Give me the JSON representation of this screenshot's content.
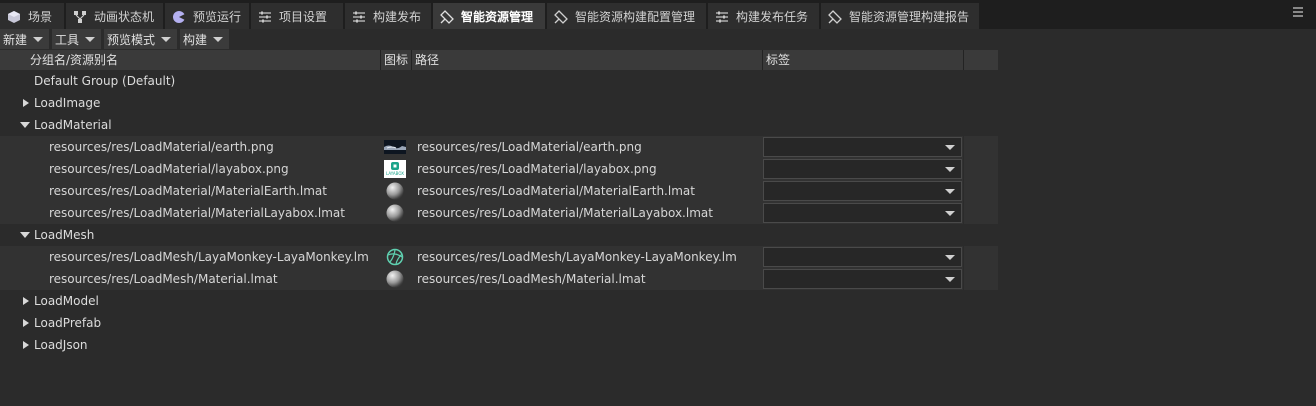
{
  "tabs": [
    {
      "label": "场景",
      "icon": "scene-icon"
    },
    {
      "label": "动画状态机",
      "icon": "state-machine-icon"
    },
    {
      "label": "预览运行",
      "icon": "preview-run-icon"
    },
    {
      "label": "项目设置",
      "icon": "settings-sliders-icon"
    },
    {
      "label": "构建发布",
      "icon": "build-publish-icon"
    },
    {
      "label": "智能资源管理",
      "icon": "smart-asset-icon"
    },
    {
      "label": "智能资源构建配置管理",
      "icon": "smart-asset-config-icon"
    },
    {
      "label": "构建发布任务",
      "icon": "build-task-icon"
    },
    {
      "label": "智能资源管理构建报告",
      "icon": "smart-asset-report-icon"
    }
  ],
  "active_tab": "智能资源管理",
  "toolbar": {
    "new": "新建",
    "tools": "工具",
    "preview_mode": "预览模式",
    "build": "构建"
  },
  "columns": {
    "name": "分组名/资源别名",
    "icon": "图标",
    "path": "路径",
    "tag": "标签"
  },
  "default_group": "Default Group (Default)",
  "groups": [
    {
      "name": "LoadImage",
      "expanded": false
    },
    {
      "name": "LoadMaterial",
      "expanded": true
    },
    {
      "name": "LoadMesh",
      "expanded": true
    },
    {
      "name": "LoadModel",
      "expanded": false
    },
    {
      "name": "LoadPrefab",
      "expanded": false
    },
    {
      "name": "LoadJson",
      "expanded": false
    }
  ],
  "assets": {
    "material_earth_png": {
      "name": "resources/res/LoadMaterial/earth.png",
      "path": "resources/res/LoadMaterial/earth.png",
      "thumb": "earth-thumbnail"
    },
    "material_layabox_png": {
      "name": "resources/res/LoadMaterial/layabox.png",
      "path": "resources/res/LoadMaterial/layabox.png",
      "thumb": "layabox-thumbnail",
      "thumb_text": "LAYABOX"
    },
    "material_earth_lmat": {
      "name": "resources/res/LoadMaterial/MaterialEarth.lmat",
      "path": "resources/res/LoadMaterial/MaterialEarth.lmat",
      "thumb": "material-sphere-icon"
    },
    "material_layabox_lmat": {
      "name": "resources/res/LoadMaterial/MaterialLayabox.lmat",
      "path": "resources/res/LoadMaterial/MaterialLayabox.lmat",
      "thumb": "material-sphere-icon"
    },
    "mesh_monkey": {
      "name": "resources/res/LoadMesh/LayaMonkey-LayaMonkey.lm",
      "path": "resources/res/LoadMesh/LayaMonkey-LayaMonkey.lm",
      "thumb": "mesh-icon"
    },
    "mesh_material": {
      "name": "resources/res/LoadMesh/Material.lmat",
      "path": "resources/res/LoadMesh/Material.lmat",
      "thumb": "material-sphere-icon"
    }
  },
  "colors": {
    "background": "#2b2b2b",
    "tabbar": "#1e1e1e",
    "header": "#3a3a3a",
    "mesh_icon": "#5fd0b0"
  }
}
